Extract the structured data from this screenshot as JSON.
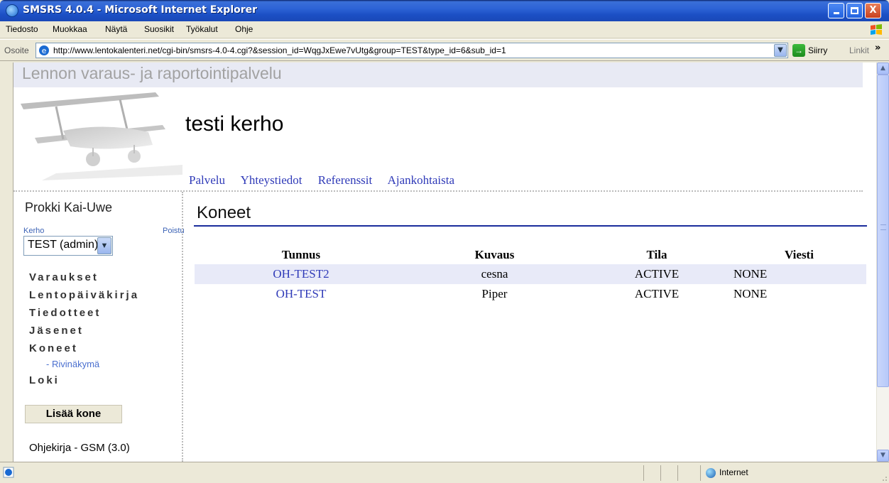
{
  "window": {
    "title": "SMSRS 4.0.4 - Microsoft Internet Explorer",
    "minimize_label": "",
    "close_label": "X"
  },
  "menubar": {
    "items": [
      {
        "label": "Tiedosto"
      },
      {
        "label": "Muokkaa"
      },
      {
        "label": "Näytä"
      },
      {
        "label": "Suosikit"
      },
      {
        "label": "Työkalut"
      },
      {
        "label": "Ohje"
      }
    ]
  },
  "addressbar": {
    "label": "Osoite",
    "url": "http://www.lentokalenteri.net/cgi-bin/smsrs-4.0-4.cgi?&session_id=WqgJxEwe7vUtg&group=TEST&type_id=6&sub_id=1",
    "go_label": "Siirry",
    "links_label": "Linkit",
    "links_chevron": "»"
  },
  "header": {
    "site_title": "Lennon varaus- ja raportointipalvelu",
    "club_name": "testi kerho",
    "nav": [
      "Palvelu",
      "Yhteystiedot",
      "Referenssit",
      "Ajankohtaista"
    ]
  },
  "sidebar": {
    "user_name": "Prokki Kai-Uwe",
    "club_label": "Kerho",
    "logout_label": "Poistu",
    "club_select_value": "TEST (admin)",
    "nav": [
      {
        "label": "Varaukset"
      },
      {
        "label": "Lentopäiväkirja"
      },
      {
        "label": "Tiedotteet"
      },
      {
        "label": "Jäsenet"
      },
      {
        "label": "Koneet"
      }
    ],
    "sub_item": "- Rivinäkymä",
    "last_nav": "Loki",
    "add_button": "Lisää kone",
    "help_link": "Ohjekirja - GSM (3.0)"
  },
  "main": {
    "heading": "Koneet",
    "columns": [
      "Tunnus",
      "Kuvaus",
      "Tila",
      "Viesti"
    ],
    "rows": [
      {
        "id": "OH-TEST2",
        "desc": "cesna",
        "status": "ACTIVE",
        "message": "NONE"
      },
      {
        "id": "OH-TEST",
        "desc": "Piper",
        "status": "ACTIVE",
        "message": "NONE"
      }
    ]
  },
  "statusbar": {
    "zone": "Internet"
  },
  "colors": {
    "link": "#2f3ab8",
    "heading_rule": "#1a2c9c",
    "row_highlight": "#e8eaf8",
    "title_bar": "#2d63d6"
  },
  "icons": {
    "window": "ie-icon",
    "go": "go-arrow-icon",
    "zone": "globe-icon"
  }
}
